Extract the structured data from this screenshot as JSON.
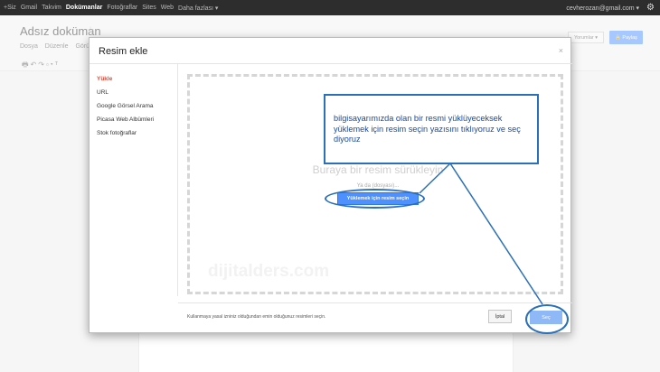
{
  "topbar": {
    "nav": [
      "+Siz",
      "Gmail",
      "Takvim",
      "Dokümanlar",
      "Fotoğraflar",
      "Sites",
      "Web",
      "Daha fazlası ▾"
    ],
    "active_index": 3,
    "account": "cevherozan@gmail.com ▾",
    "gear_icon": "gear-icon"
  },
  "document": {
    "title": "Adsız doküman",
    "menu": [
      "Dosya",
      "Düzenle",
      "Görü"
    ],
    "comments_label": "Yorumlar ▾",
    "share_label": "🔒 Paylaş"
  },
  "dialog": {
    "title": "Resim ekle",
    "close": "×",
    "sidebar": [
      "Yükle",
      "URL",
      "Google Görsel Arama",
      "Picasa Web Albümleri",
      "Stok fotoğraflar"
    ],
    "active_item": "Yükle",
    "drop_text": "Buraya bir resim sürükleyin",
    "or_text": "Ya da (dosyası)...",
    "upload_button": "Yüklemek için resim seçin",
    "watermark": "dijitalders.com",
    "footer_text": "Kullanmaya yasal izniniz olduğundan emin olduğunuz resimleri seçin.",
    "cancel_button": "İptal",
    "select_button": "Seç"
  },
  "annotation": {
    "text": "bilgisayarımızda olan bir resmi yüklüyeceksek yüklemek için resim seçin yazısını tıklıyoruz ve seç diyoruz",
    "color": "#2b6fb8"
  }
}
